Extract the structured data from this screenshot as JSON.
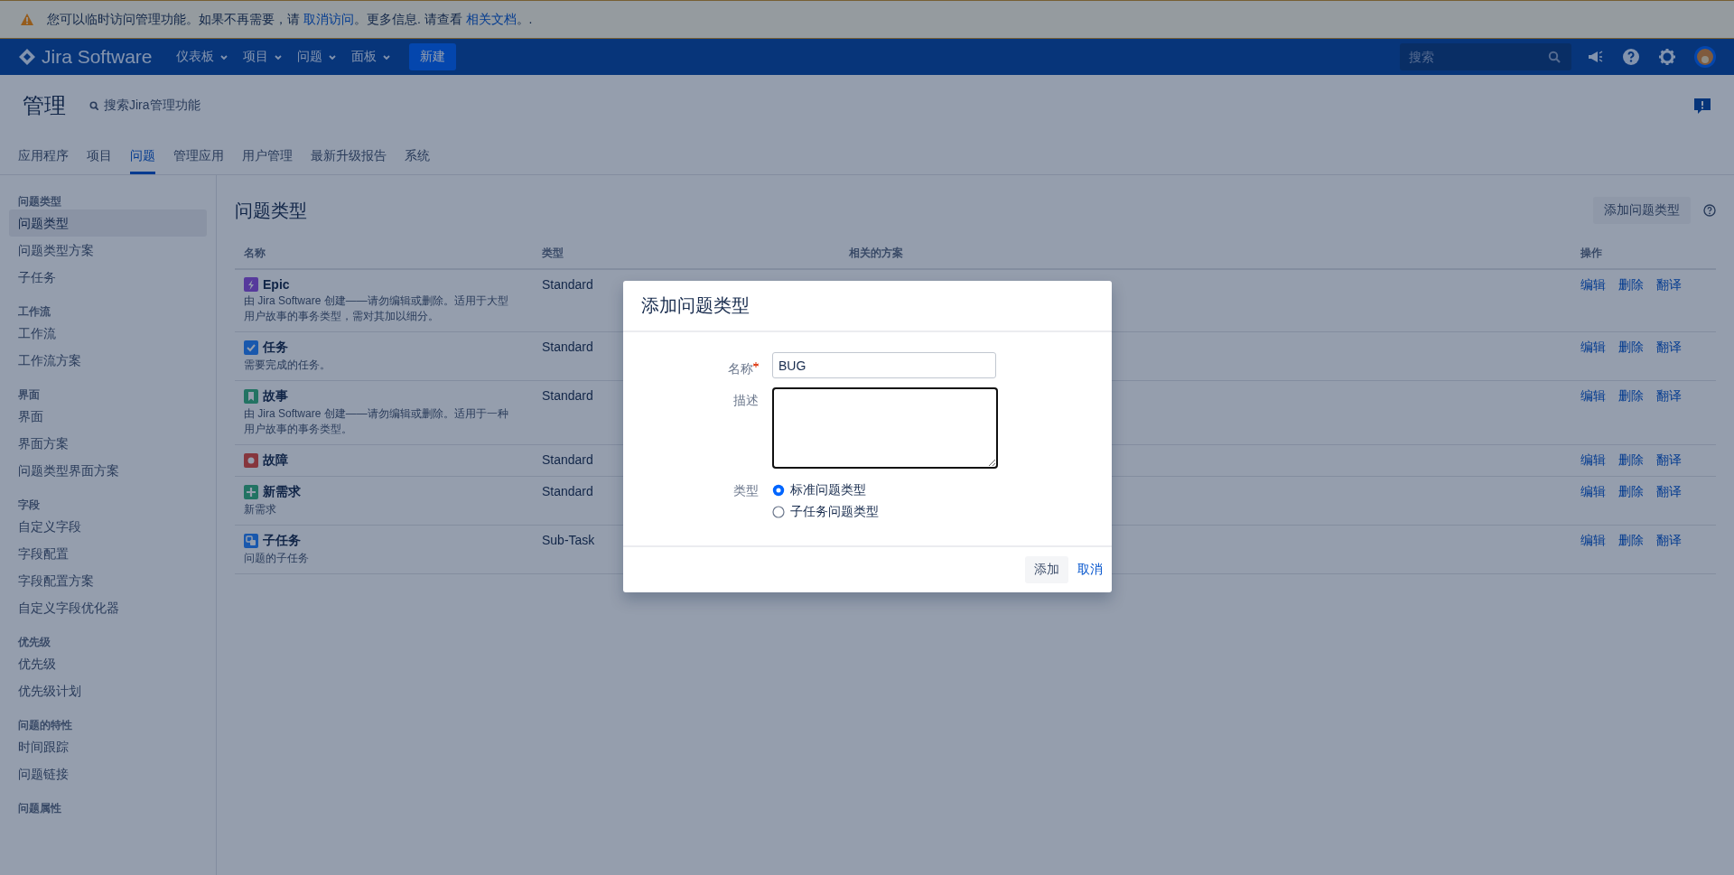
{
  "banner": {
    "segments": [
      {
        "kind": "text",
        "text": "您可以临时访问管理功能。如果不再需要，请 "
      },
      {
        "kind": "link",
        "text": "取消访问"
      },
      {
        "kind": "text",
        "text": "。更多信息. 请查看 "
      },
      {
        "kind": "link",
        "text": "相关文档"
      },
      {
        "kind": "text",
        "text": "。."
      }
    ]
  },
  "nav": {
    "logo": "Jira Software",
    "menus": [
      "仪表板",
      "项目",
      "问题",
      "面板"
    ],
    "create": "新建",
    "search_placeholder": "搜索"
  },
  "header": {
    "title": "管理",
    "search": "搜索Jira管理功能"
  },
  "tabs": [
    {
      "label": "应用程序",
      "selected": false
    },
    {
      "label": "项目",
      "selected": false
    },
    {
      "label": "问题",
      "selected": true
    },
    {
      "label": "管理应用",
      "selected": false
    },
    {
      "label": "用户管理",
      "selected": false
    },
    {
      "label": "最新升级报告",
      "selected": false
    },
    {
      "label": "系统",
      "selected": false
    }
  ],
  "sidebar": {
    "sections": [
      {
        "heading": "问题类型",
        "items": [
          {
            "label": "问题类型",
            "selected": true
          },
          {
            "label": "问题类型方案",
            "selected": false
          },
          {
            "label": "子任务",
            "selected": false
          }
        ]
      },
      {
        "heading": "工作流",
        "items": [
          {
            "label": "工作流",
            "selected": false
          },
          {
            "label": "工作流方案",
            "selected": false
          }
        ]
      },
      {
        "heading": "界面",
        "items": [
          {
            "label": "界面",
            "selected": false
          },
          {
            "label": "界面方案",
            "selected": false
          },
          {
            "label": "问题类型界面方案",
            "selected": false
          }
        ]
      },
      {
        "heading": "字段",
        "items": [
          {
            "label": "自定义字段",
            "selected": false
          },
          {
            "label": "字段配置",
            "selected": false
          },
          {
            "label": "字段配置方案",
            "selected": false
          },
          {
            "label": "自定义字段优化器",
            "selected": false
          }
        ]
      },
      {
        "heading": "优先级",
        "items": [
          {
            "label": "优先级",
            "selected": false
          },
          {
            "label": "优先级计划",
            "selected": false
          }
        ]
      },
      {
        "heading": "问题的特性",
        "items": [
          {
            "label": "时间跟踪",
            "selected": false
          },
          {
            "label": "问题链接",
            "selected": false
          }
        ]
      },
      {
        "heading": "问题属性"
      }
    ]
  },
  "content": {
    "title": "问题类型",
    "add_button": "添加问题类型"
  },
  "table": {
    "columns": [
      "名称",
      "类型",
      "相关的方案",
      "操作"
    ],
    "rows": [
      {
        "kind": "epic",
        "name": "Epic",
        "description": "由 Jira Software 创建——请勿编辑或删除。适用于大型用户故事的事务类型，需对其加以细分。",
        "type": "Standard",
        "actions": [
          "编辑",
          "删除",
          "翻译"
        ]
      },
      {
        "kind": "task",
        "name": "任务",
        "description": "需要完成的任务。",
        "type": "Standard",
        "actions": [
          "编辑",
          "删除",
          "翻译"
        ]
      },
      {
        "kind": "story",
        "name": "故事",
        "description": "由 Jira Software 创建——请勿编辑或删除。适用于一种用户故事的事务类型。",
        "type": "Standard",
        "actions": [
          "编辑",
          "删除",
          "翻译"
        ]
      },
      {
        "kind": "bug",
        "name": "故障",
        "type": "Standard",
        "actions": [
          "编辑",
          "删除",
          "翻译"
        ]
      },
      {
        "kind": "new-feature",
        "name": "新需求",
        "description": "新需求",
        "type": "Standard",
        "actions": [
          "编辑",
          "删除",
          "翻译"
        ]
      },
      {
        "kind": "subtask",
        "name": "子任务",
        "description": "问题的子任务",
        "type": "Sub-Task",
        "actions": [
          "编辑",
          "删除",
          "翻译"
        ]
      }
    ]
  },
  "dialog": {
    "title": "添加问题类型",
    "fields": [
      {
        "kind": "text",
        "label": "名称",
        "required": true,
        "value": "BUG"
      },
      {
        "kind": "textarea",
        "label": "描述",
        "required": false,
        "focused": true
      },
      {
        "kind": "radio",
        "label": "类型",
        "required": false,
        "options": [
          {
            "label": "标准问题类型",
            "selected": true
          },
          {
            "label": "子任务问题类型",
            "selected": false
          }
        ]
      }
    ],
    "buttons": [
      {
        "kind": "primary",
        "label": "添加"
      },
      {
        "kind": "link",
        "label": "取消"
      }
    ]
  }
}
